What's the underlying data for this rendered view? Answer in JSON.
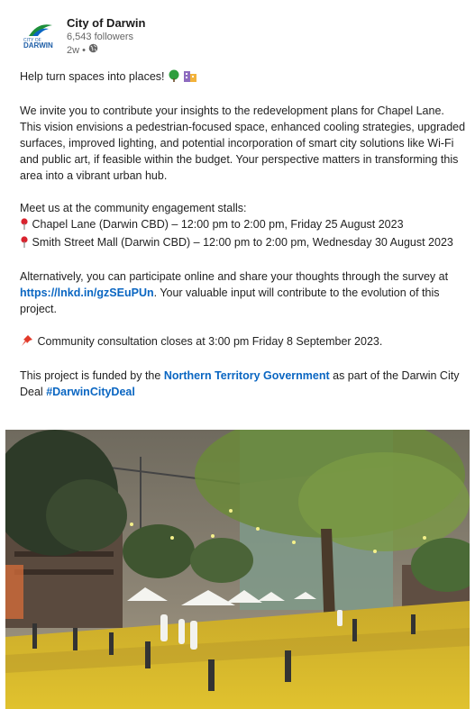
{
  "header": {
    "author": "City of Darwin",
    "followers": "6,543 followers",
    "time": "2w •",
    "logo_text_top": "CITY OF",
    "logo_text_main": "DARWIN",
    "globe_icon": "globe-icon"
  },
  "post": {
    "headline": "Help turn spaces into places!",
    "para1": "We invite you to contribute your insights to the redevelopment plans for Chapel Lane. This vision envisions a pedestrian-focused space, enhanced cooling strategies, upgraded surfaces, improved lighting, and potential incorporation of smart city solutions like Wi-Fi and public art, if feasible within the budget. Your perspective matters in transforming this area into a vibrant urban hub.",
    "meet": "Meet us at the community engagement stalls:",
    "stall1": "Chapel Lane (Darwin CBD) – 12:00 pm to 2:00 pm, Friday 25 August 2023",
    "stall2": "Smith Street Mall (Darwin CBD) – 12:00 pm to 2:00 pm, Wednesday 30 August 2023",
    "alt_before": "Alternatively, you can participate online and share your thoughts through the survey at ",
    "survey_link": "https://lnkd.in/gzSEuPUn",
    "alt_after": ". Your valuable input will contribute to the evolution of this project.",
    "closes": "Community consultation closes at 3:00 pm Friday 8 September 2023.",
    "funded_before": "This project is funded by the ",
    "funded_link": "Northern Territory Government",
    "funded_after": " as part of the Darwin City Deal ",
    "hashtag": "#DarwinCityDeal"
  },
  "colors": {
    "link": "#0a66c2",
    "pin_red": "#d9232e",
    "tree_green": "#2e9e3e",
    "building_purple": "#8e6bbf",
    "pushpin_red": "#e23a2a"
  },
  "icons": [
    "tree-emoji-icon",
    "building-emoji-icon",
    "pin-icon",
    "pushpin-icon"
  ]
}
